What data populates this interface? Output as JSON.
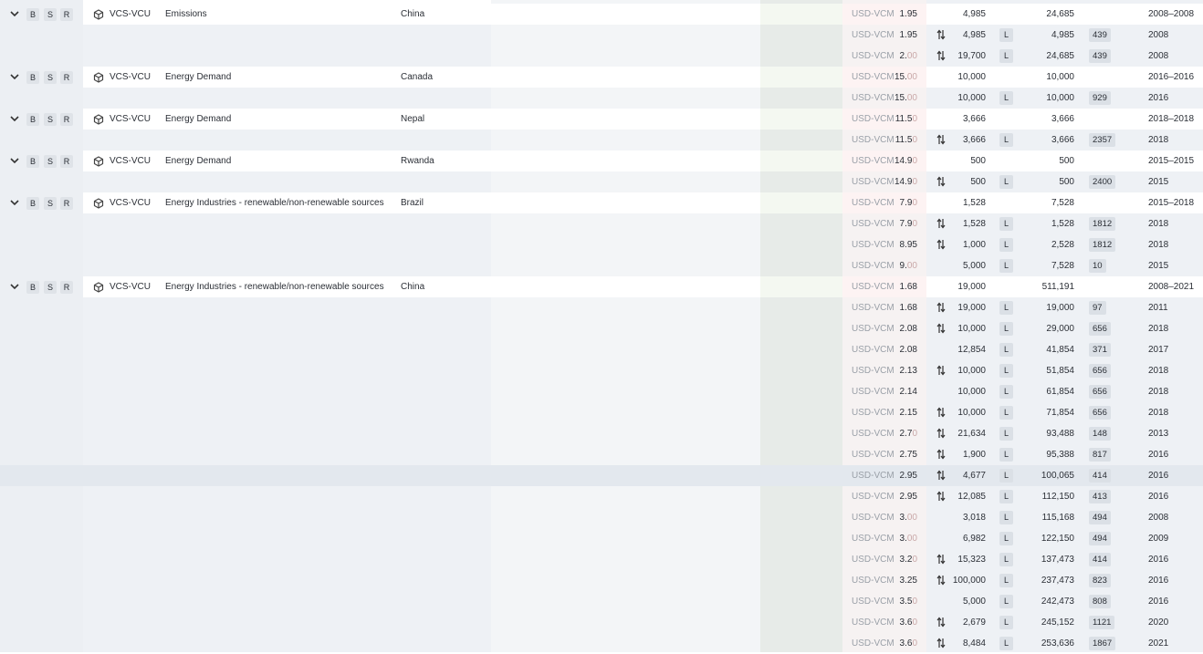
{
  "row_buttons": {
    "b": "B",
    "s": "S",
    "r": "R"
  },
  "icons": {
    "expand": "chevron-down-icon",
    "project": "cube-icon",
    "trade": "arrows-up-down-icon"
  },
  "groups": [
    {
      "registry": "VCS-VCU",
      "category": "Emissions",
      "country": "China",
      "summary": {
        "currency": "USD-VCM",
        "price": "1.95",
        "price_dim": "",
        "quantity": "4,985",
        "cumulative": "24,685",
        "vintage": "2008–2008"
      },
      "rows": [
        {
          "currency": "USD-VCM",
          "price": "1.95",
          "price_dim": "",
          "trade": true,
          "quantity": "4,985",
          "type": "L",
          "cumulative": "4,985",
          "id": "439",
          "year": "2008"
        },
        {
          "currency": "USD-VCM",
          "price": "2.",
          "price_dim": "00",
          "trade": true,
          "quantity": "19,700",
          "type": "L",
          "cumulative": "24,685",
          "id": "439",
          "year": "2008"
        }
      ]
    },
    {
      "registry": "VCS-VCU",
      "category": "Energy Demand",
      "country": "Canada",
      "summary": {
        "currency": "USD-VCM",
        "price": "15.",
        "price_dim": "00",
        "quantity": "10,000",
        "cumulative": "10,000",
        "vintage": "2016–2016"
      },
      "rows": [
        {
          "currency": "USD-VCM",
          "price": "15.",
          "price_dim": "00",
          "trade": false,
          "quantity": "10,000",
          "type": "L",
          "cumulative": "10,000",
          "id": "929",
          "year": "2016"
        }
      ]
    },
    {
      "registry": "VCS-VCU",
      "category": "Energy Demand",
      "country": "Nepal",
      "summary": {
        "currency": "USD-VCM",
        "price": "11.5",
        "price_dim": "0",
        "quantity": "3,666",
        "cumulative": "3,666",
        "vintage": "2018–2018"
      },
      "rows": [
        {
          "currency": "USD-VCM",
          "price": "11.5",
          "price_dim": "0",
          "trade": true,
          "quantity": "3,666",
          "type": "L",
          "cumulative": "3,666",
          "id": "2357",
          "year": "2018"
        }
      ]
    },
    {
      "registry": "VCS-VCU",
      "category": "Energy Demand",
      "country": "Rwanda",
      "summary": {
        "currency": "USD-VCM",
        "price": "14.9",
        "price_dim": "0",
        "quantity": "500",
        "cumulative": "500",
        "vintage": "2015–2015"
      },
      "rows": [
        {
          "currency": "USD-VCM",
          "price": "14.9",
          "price_dim": "0",
          "trade": true,
          "quantity": "500",
          "type": "L",
          "cumulative": "500",
          "id": "2400",
          "year": "2015"
        }
      ]
    },
    {
      "registry": "VCS-VCU",
      "category": "Energy Industries - renewable/non-renewable sources",
      "country": "Brazil",
      "summary": {
        "currency": "USD-VCM",
        "price": "7.9",
        "price_dim": "0",
        "quantity": "1,528",
        "cumulative": "7,528",
        "vintage": "2015–2018"
      },
      "rows": [
        {
          "currency": "USD-VCM",
          "price": "7.9",
          "price_dim": "0",
          "trade": true,
          "quantity": "1,528",
          "type": "L",
          "cumulative": "1,528",
          "id": "1812",
          "year": "2018"
        },
        {
          "currency": "USD-VCM",
          "price": "8.95",
          "price_dim": "",
          "trade": true,
          "quantity": "1,000",
          "type": "L",
          "cumulative": "2,528",
          "id": "1812",
          "year": "2018"
        },
        {
          "currency": "USD-VCM",
          "price": "9.",
          "price_dim": "00",
          "trade": false,
          "quantity": "5,000",
          "type": "L",
          "cumulative": "7,528",
          "id": "10",
          "year": "2015"
        }
      ]
    },
    {
      "registry": "VCS-VCU",
      "category": "Energy Industries - renewable/non-renewable sources",
      "country": "China",
      "summary": {
        "currency": "USD-VCM",
        "price": "1.68",
        "price_dim": "",
        "quantity": "19,000",
        "cumulative": "511,191",
        "vintage": "2008–2021"
      },
      "rows": [
        {
          "currency": "USD-VCM",
          "price": "1.68",
          "price_dim": "",
          "trade": true,
          "quantity": "19,000",
          "type": "L",
          "cumulative": "19,000",
          "id": "97",
          "year": "2011"
        },
        {
          "currency": "USD-VCM",
          "price": "2.08",
          "price_dim": "",
          "trade": true,
          "quantity": "10,000",
          "type": "L",
          "cumulative": "29,000",
          "id": "656",
          "year": "2018"
        },
        {
          "currency": "USD-VCM",
          "price": "2.08",
          "price_dim": "",
          "trade": false,
          "quantity": "12,854",
          "type": "L",
          "cumulative": "41,854",
          "id": "371",
          "year": "2017"
        },
        {
          "currency": "USD-VCM",
          "price": "2.13",
          "price_dim": "",
          "trade": true,
          "quantity": "10,000",
          "type": "L",
          "cumulative": "51,854",
          "id": "656",
          "year": "2018"
        },
        {
          "currency": "USD-VCM",
          "price": "2.14",
          "price_dim": "",
          "trade": false,
          "quantity": "10,000",
          "type": "L",
          "cumulative": "61,854",
          "id": "656",
          "year": "2018"
        },
        {
          "currency": "USD-VCM",
          "price": "2.15",
          "price_dim": "",
          "trade": true,
          "quantity": "10,000",
          "type": "L",
          "cumulative": "71,854",
          "id": "656",
          "year": "2018"
        },
        {
          "currency": "USD-VCM",
          "price": "2.7",
          "price_dim": "0",
          "trade": true,
          "quantity": "21,634",
          "type": "L",
          "cumulative": "93,488",
          "id": "148",
          "year": "2013"
        },
        {
          "currency": "USD-VCM",
          "price": "2.75",
          "price_dim": "",
          "trade": true,
          "quantity": "1,900",
          "type": "L",
          "cumulative": "95,388",
          "id": "817",
          "year": "2016"
        },
        {
          "currency": "USD-VCM",
          "price": "2.95",
          "price_dim": "",
          "trade": true,
          "quantity": "4,677",
          "type": "L",
          "cumulative": "100,065",
          "id": "414",
          "year": "2016",
          "highlight": true
        },
        {
          "currency": "USD-VCM",
          "price": "2.95",
          "price_dim": "",
          "trade": true,
          "quantity": "12,085",
          "type": "L",
          "cumulative": "112,150",
          "id": "413",
          "year": "2016"
        },
        {
          "currency": "USD-VCM",
          "price": "3.",
          "price_dim": "00",
          "trade": false,
          "quantity": "3,018",
          "type": "L",
          "cumulative": "115,168",
          "id": "494",
          "year": "2008"
        },
        {
          "currency": "USD-VCM",
          "price": "3.",
          "price_dim": "00",
          "trade": false,
          "quantity": "6,982",
          "type": "L",
          "cumulative": "122,150",
          "id": "494",
          "year": "2009"
        },
        {
          "currency": "USD-VCM",
          "price": "3.2",
          "price_dim": "0",
          "trade": true,
          "quantity": "15,323",
          "type": "L",
          "cumulative": "137,473",
          "id": "414",
          "year": "2016"
        },
        {
          "currency": "USD-VCM",
          "price": "3.25",
          "price_dim": "",
          "trade": true,
          "quantity": "100,000",
          "type": "L",
          "cumulative": "237,473",
          "id": "823",
          "year": "2016"
        },
        {
          "currency": "USD-VCM",
          "price": "3.5",
          "price_dim": "0",
          "trade": false,
          "quantity": "5,000",
          "type": "L",
          "cumulative": "242,473",
          "id": "808",
          "year": "2016"
        },
        {
          "currency": "USD-VCM",
          "price": "3.6",
          "price_dim": "0",
          "trade": true,
          "quantity": "2,679",
          "type": "L",
          "cumulative": "245,152",
          "id": "1121",
          "year": "2020"
        },
        {
          "currency": "USD-VCM",
          "price": "3.6",
          "price_dim": "0",
          "trade": true,
          "quantity": "8,484",
          "type": "L",
          "cumulative": "253,636",
          "id": "1867",
          "year": "2021"
        }
      ]
    }
  ]
}
